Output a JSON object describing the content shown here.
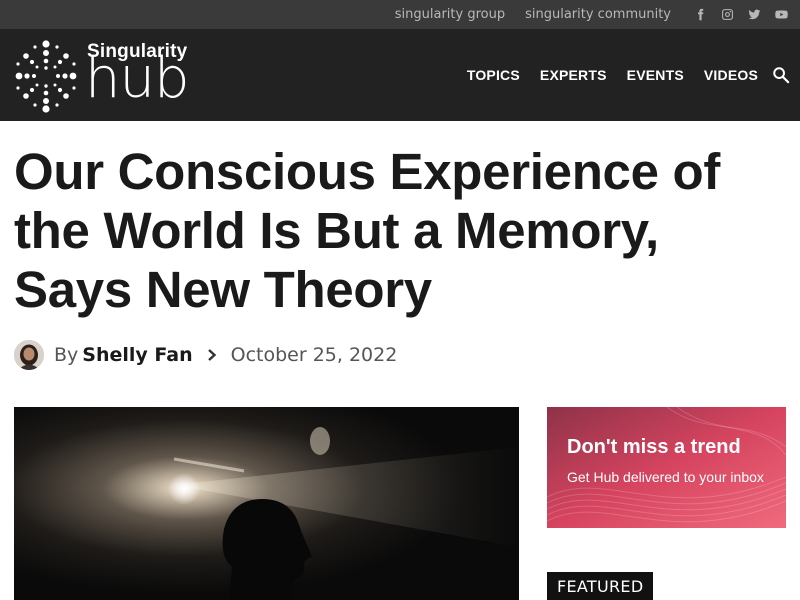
{
  "topbar": {
    "links": [
      "singularity group",
      "singularity community"
    ],
    "social_icons": [
      "facebook-icon",
      "instagram-icon",
      "twitter-icon",
      "youtube-icon"
    ]
  },
  "header": {
    "logo_small": "Singularity",
    "logo_big": "hub",
    "nav": [
      "TOPICS",
      "EXPERTS",
      "EVENTS",
      "VIDEOS"
    ],
    "search_icon": "search-icon"
  },
  "article": {
    "title": "Our Conscious Experience of the World Is But a Memory, Says New Theory",
    "by": "By",
    "author": "Shelly Fan",
    "date": "October 25, 2022"
  },
  "sidebar": {
    "promo_title": "Don't miss a trend",
    "promo_subtitle": "Get Hub delivered to your inbox",
    "featured_label": "FEATURED"
  },
  "colors": {
    "topbar_bg": "#3a3a3a",
    "header_bg": "#222222",
    "promo_accent": "#d94a64",
    "featured_bg": "#111111"
  }
}
